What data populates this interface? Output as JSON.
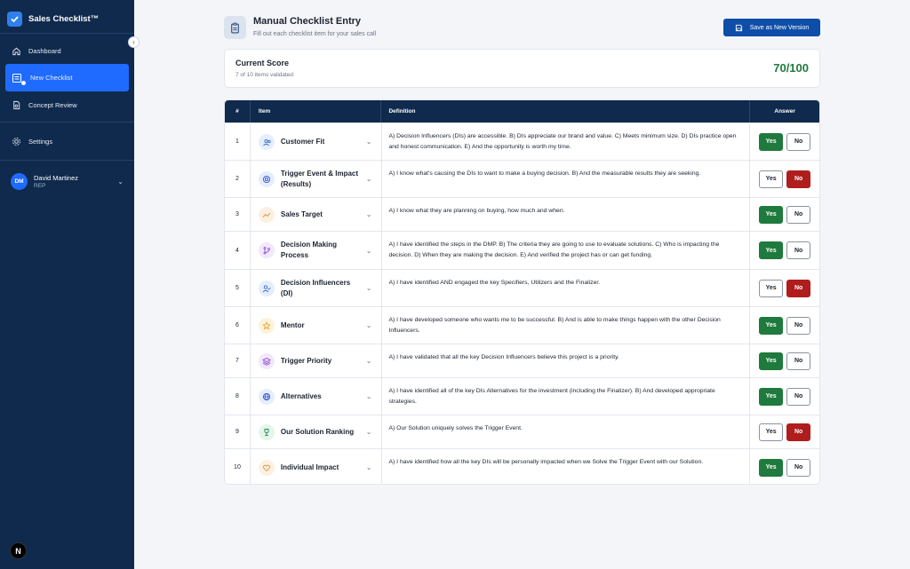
{
  "app": {
    "name": "Sales Checklist™"
  },
  "sidebar": {
    "items": [
      {
        "label": "Dashboard",
        "icon": "home-icon"
      },
      {
        "label": "New Checklist",
        "icon": "checklist-icon"
      },
      {
        "label": "Concept Review",
        "icon": "document-icon"
      },
      {
        "label": "Settings",
        "icon": "gear-icon"
      }
    ],
    "user": {
      "initials": "DM",
      "name": "David Martinez",
      "role": "REP"
    },
    "badge": "N"
  },
  "header": {
    "title": "Manual Checklist Entry",
    "subtitle": "Fill out each checklist item for your sales call",
    "save_label": "Save as New Version"
  },
  "score": {
    "title": "Current Score",
    "subtitle": "7 of 10 items validated",
    "value": "70/100"
  },
  "table": {
    "headers": {
      "num": "#",
      "item": "Item",
      "definition": "Definition",
      "answer": "Answer"
    },
    "yes_label": "Yes",
    "no_label": "No",
    "rows": [
      {
        "num": "1",
        "item": "Customer Fit",
        "icon": "users-icon",
        "icon_bg": "#e6eefb",
        "icon_color": "#2f6bd8",
        "definition": "A) Decision Influencers (DIs) are accessible. B) DIs appreciate our brand and value. C) Meets minimum size. D) DIs practice open and honest communication. E) And the opportunity is worth my time.",
        "answer": "yes"
      },
      {
        "num": "2",
        "item": "Trigger Event & Impact (Results)",
        "icon": "target-icon",
        "icon_bg": "#e6eefb",
        "icon_color": "#2f4fd8",
        "definition": "A) I know what's causing the DIs to want to make a buying decision. B) And the measurable results they are seeking.",
        "answer": "no"
      },
      {
        "num": "3",
        "item": "Sales Target",
        "icon": "trending-up-icon",
        "icon_bg": "#fdf0e2",
        "icon_color": "#e08a2a",
        "definition": "A) I know what they are planning on buying, how much and when.",
        "answer": "yes"
      },
      {
        "num": "4",
        "item": "Decision Making Process",
        "icon": "branch-icon",
        "icon_bg": "#f1e8fb",
        "icon_color": "#8a3fd8",
        "definition": "A) I have identified the steps in the DMP. B) The criteria they are going to use to evaluate solutions. C) Who is impacting the decision. D) When they are making the decision. E) And verified the project has or can get funding.",
        "answer": "yes"
      },
      {
        "num": "5",
        "item": "Decision Influencers (DI)",
        "icon": "user-check-icon",
        "icon_bg": "#e6eefb",
        "icon_color": "#2f6bd8",
        "definition": "A) I have identified AND engaged the key Specifiers, Utilizers and the Finalizer.",
        "answer": "no"
      },
      {
        "num": "6",
        "item": "Mentor",
        "icon": "star-icon",
        "icon_bg": "#fdf3dc",
        "icon_color": "#e0a21f",
        "definition": "A) I have developed someone who wants me to be successful. B) And is able to make things happen with the other Decision Influencers.",
        "answer": "yes"
      },
      {
        "num": "7",
        "item": "Trigger Priority",
        "icon": "layers-icon",
        "icon_bg": "#f1e8fb",
        "icon_color": "#8a3fd8",
        "definition": "A) I have validated that all the key Decision Influencers believe this project is a priority.",
        "answer": "yes"
      },
      {
        "num": "8",
        "item": "Alternatives",
        "icon": "globe-icon",
        "icon_bg": "#e6eefb",
        "icon_color": "#2f4fd8",
        "definition": "A) I have identified all of the key DIs Alternatives for the investment (including the Finalizer). B) And developed appropriate strategies.",
        "answer": "yes"
      },
      {
        "num": "9",
        "item": "Our Solution Ranking",
        "icon": "trophy-icon",
        "icon_bg": "#e4f5ea",
        "icon_color": "#1f8a4d",
        "definition": "A) Our Solution uniquely solves the Trigger Event.",
        "answer": "no"
      },
      {
        "num": "10",
        "item": "Individual Impact",
        "icon": "heart-icon",
        "icon_bg": "#fdf0e2",
        "icon_color": "#e08a2a",
        "definition": "A) I have identified how all the key DIs will be personally impacted when we Solve the Trigger Event with our Solution.",
        "answer": "yes"
      }
    ]
  },
  "colors": {
    "sidebar": "#0f2a4d",
    "accent": "#1f6bff",
    "yes": "#1f7a3d",
    "no": "#b01d1d"
  }
}
